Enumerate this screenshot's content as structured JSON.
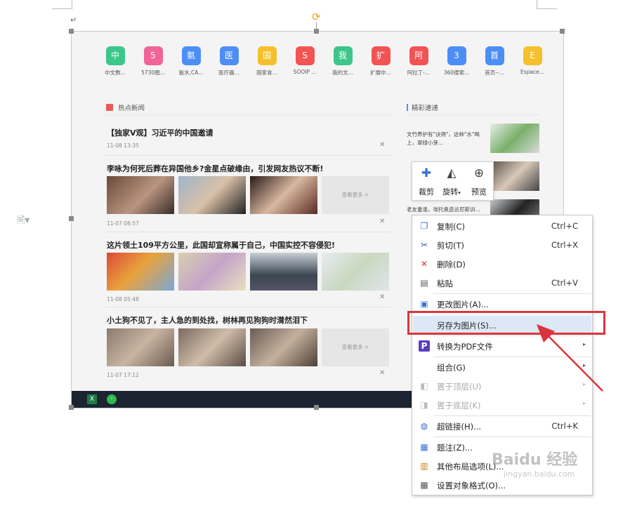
{
  "document": {
    "paragraph_mark": "↵",
    "rotate_symbol": "⟳"
  },
  "screenshot": {
    "shortcuts": [
      {
        "glyph": "中",
        "label": "中文数...",
        "color": "#3cc68a"
      },
      {
        "glyph": "5",
        "label": "5730图...",
        "color": "#f06595"
      },
      {
        "glyph": "氨",
        "label": "氨水,CA...",
        "color": "#4c8ef5"
      },
      {
        "glyph": "医",
        "label": "医疗器...",
        "color": "#4c8ef5"
      },
      {
        "glyph": "国",
        "label": "国家食...",
        "color": "#f5c02c"
      },
      {
        "glyph": "S",
        "label": "SOOIP ...",
        "color": "#f25454"
      },
      {
        "glyph": "我",
        "label": "我的文...",
        "color": "#3cc68a"
      },
      {
        "glyph": "扩",
        "label": "扩展中...",
        "color": "#f25454"
      },
      {
        "glyph": "阿",
        "label": "阿拉丁-...",
        "color": "#f25454"
      },
      {
        "glyph": "3",
        "label": "360搜索...",
        "color": "#4c8ef5"
      },
      {
        "glyph": "首",
        "label": "首页--...",
        "color": "#4c8ef5"
      },
      {
        "glyph": "E",
        "label": "Espace...",
        "color": "#f5c02c"
      }
    ],
    "hot_news_title": "热点新闻",
    "side_title": "精彩速递",
    "news": [
      {
        "title": "【独家V观】习近平的中国邀请",
        "time": "11-08 13:35"
      },
      {
        "title": "李咏为何死后葬在异国他乡?金星点破缘由，引发网友热议不断!",
        "time": "11-07 08:57",
        "more": "查看更多 >"
      },
      {
        "title": "这片领土109平方公里，此国却宣称属于自己，中国实控不容侵犯!",
        "time": "11-08 05:48"
      },
      {
        "title": "小土狗不见了，主人急的到处找，树林再见狗狗时潸然泪下",
        "time": "11-07 17:12",
        "more": "查看更多 >"
      }
    ],
    "side_items": [
      {
        "text": "文竹养护有\"诀窍\"，这种\"水\"喝上，翠绿小芽..."
      },
      {
        "text": "老友重逢，埃托奥造访尼斯训..."
      }
    ],
    "close_glyph": "✕"
  },
  "float_toolbar": {
    "crop": "裁剪",
    "rotate": "旋转",
    "preview": "预览"
  },
  "context_menu": {
    "items": [
      {
        "label": "复制(C)",
        "shortcut": "Ctrl+C"
      },
      {
        "label": "剪切(T)",
        "shortcut": "Ctrl+X"
      },
      {
        "label": "删除(D)",
        "shortcut": ""
      },
      {
        "label": "粘贴",
        "shortcut": "Ctrl+V"
      },
      {
        "label": "更改图片(A)...",
        "shortcut": ""
      },
      {
        "label": "另存为图片(S)...",
        "shortcut": ""
      },
      {
        "label": "转换为PDF文件",
        "shortcut": ""
      },
      {
        "label": "组合(G)",
        "shortcut": ""
      },
      {
        "label": "置于顶层(U)",
        "shortcut": ""
      },
      {
        "label": "置于底层(K)",
        "shortcut": ""
      },
      {
        "label": "超链接(H)...",
        "shortcut": "Ctrl+K"
      },
      {
        "label": "题注(Z)...",
        "shortcut": ""
      },
      {
        "label": "其他布局选项(L)...",
        "shortcut": ""
      },
      {
        "label": "设置对象格式(O)...",
        "shortcut": ""
      }
    ],
    "highlight_color": "#d9353b"
  },
  "watermark": {
    "brand": "Baidu 经验",
    "url": "jingyan.baidu.com"
  }
}
